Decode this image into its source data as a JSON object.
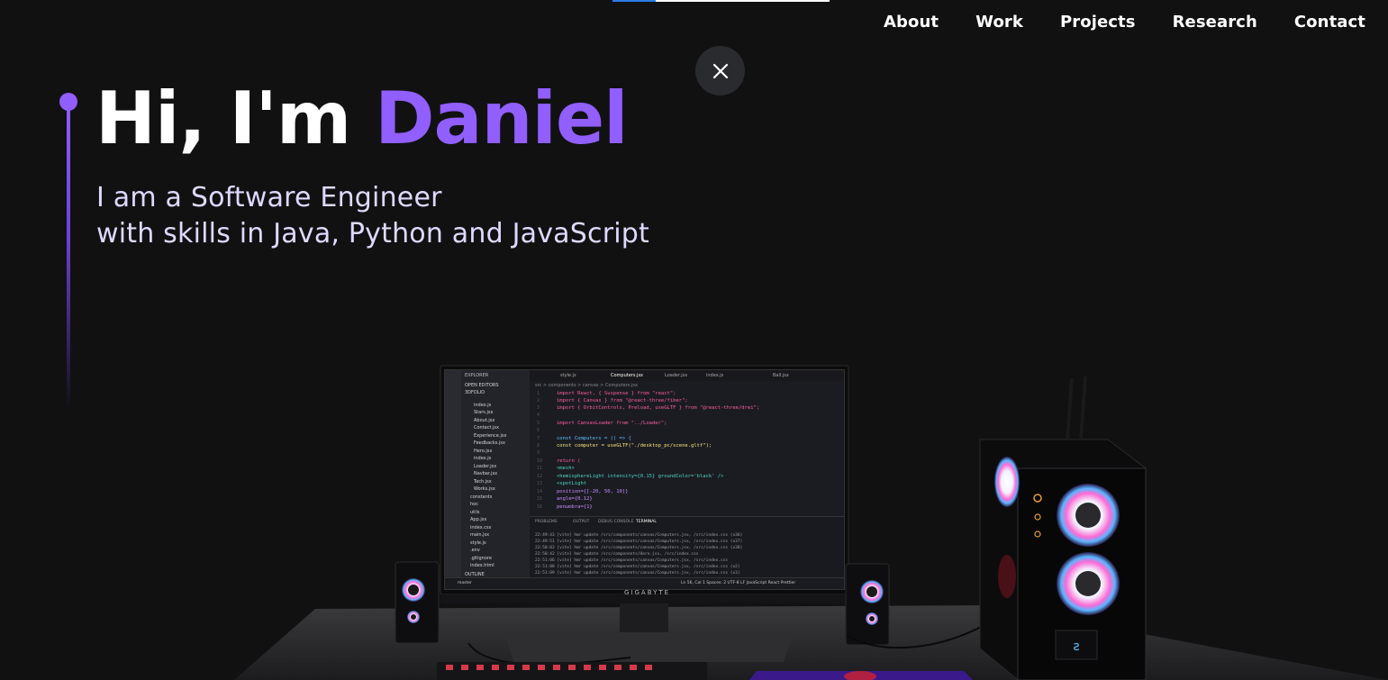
{
  "nav": {
    "items": [
      "About",
      "Work",
      "Projects",
      "Research",
      "Contact"
    ]
  },
  "close_button": {
    "icon": "close-icon"
  },
  "hero": {
    "greeting": "Hi, I'm ",
    "name": "Daniel",
    "subtitle_line1": "I am a Software Engineer",
    "subtitle_line2": "with skills in Java, Python and JavaScript"
  },
  "colors": {
    "background": "#111112",
    "accent": "#915eff",
    "subtitle": "#dfd9ff",
    "close_bg": "#2a2b2e"
  },
  "scene": {
    "description_icon": "desktop-pc-3d-scene",
    "monitor_brand": "GIGABYTE",
    "screen": {
      "explorer_title": "EXPLORER",
      "open_editors": "OPEN EDITORS",
      "project_name": "3DFOLIO",
      "files": [
        "index.js",
        "Stars.jsx",
        "About.jsx",
        "Contact.jsx",
        "Experience.jsx",
        "Feedbacks.jsx",
        "Hero.jsx",
        "index.js",
        "Loader.jsx",
        "Navbar.jsx",
        "Tech.jsx",
        "Works.jsx",
        "constants",
        "hoc",
        "utils",
        "App.jsx",
        "index.css",
        "main.jsx",
        "style.js",
        ".env",
        ".gitignore",
        "index.html",
        "OUTLINE"
      ],
      "tabs": [
        "style.js",
        "Computers.jsx",
        "Loader.jsx",
        "index.js",
        "Ball.jsx"
      ],
      "breadcrumb": "src > components > canvas > Computers.jsx",
      "code_lines": [
        {
          "n": "1",
          "text": "import React, { Suspense } from \"react\";"
        },
        {
          "n": "2",
          "text": "import { Canvas } from \"@react-three/fiber\";"
        },
        {
          "n": "3",
          "text": "import { OrbitControls, Preload, useGLTF } from \"@react-three/drei\";"
        },
        {
          "n": "4",
          "text": ""
        },
        {
          "n": "5",
          "text": "import CanvasLoader from \"../Loader\";"
        },
        {
          "n": "6",
          "text": ""
        },
        {
          "n": "7",
          "text": "const Computers = () => {"
        },
        {
          "n": "8",
          "text": "  const computer = useGLTF(\"./desktop_pc/scene.gltf\");"
        },
        {
          "n": "9",
          "text": ""
        },
        {
          "n": "10",
          "text": "  return ("
        },
        {
          "n": "11",
          "text": "    <mesh>"
        },
        {
          "n": "12",
          "text": "      <hemisphereLight intensity={0.15} groundColor='black' />"
        },
        {
          "n": "13",
          "text": "      <spotLight"
        },
        {
          "n": "14",
          "text": "        position={[-20, 50, 10]}"
        },
        {
          "n": "15",
          "text": "        angle={0.12}"
        },
        {
          "n": "16",
          "text": "        penumbra={1}"
        }
      ],
      "panel_tabs": [
        "PROBLEMS",
        "OUTPUT",
        "DEBUG CONSOLE",
        "TERMINAL"
      ],
      "terminal_lines": [
        "22:49:43 [vite] hmr update /src/components/canvas/Computers.jsx, /src/index.css (x36)",
        "22:49:51 [vite] hmr update /src/components/canvas/Computers.jsx, /src/index.css (x37)",
        "22:50:03 [vite] hmr update /src/components/canvas/Computers.jsx, /src/index.css (x38)",
        "22:50:42 [vite] hmr update /src/components/Hero.jsx, /src/index.css",
        "22:51:06 [vite] hmr update /src/components/canvas/Computers.jsx, /src/index.css",
        "22:51:08 [vite] hmr update /src/components/canvas/Computers.jsx, /src/index.css (x2)",
        "22:51:09 [vite] hmr update /src/components/canvas/Computers.jsx, /src/index.css (x3)"
      ],
      "status_left": "master",
      "status_right": "Ln 56, Col 1   Spaces: 2   UTF-8   LF   JavaScript React   Prettier"
    }
  }
}
